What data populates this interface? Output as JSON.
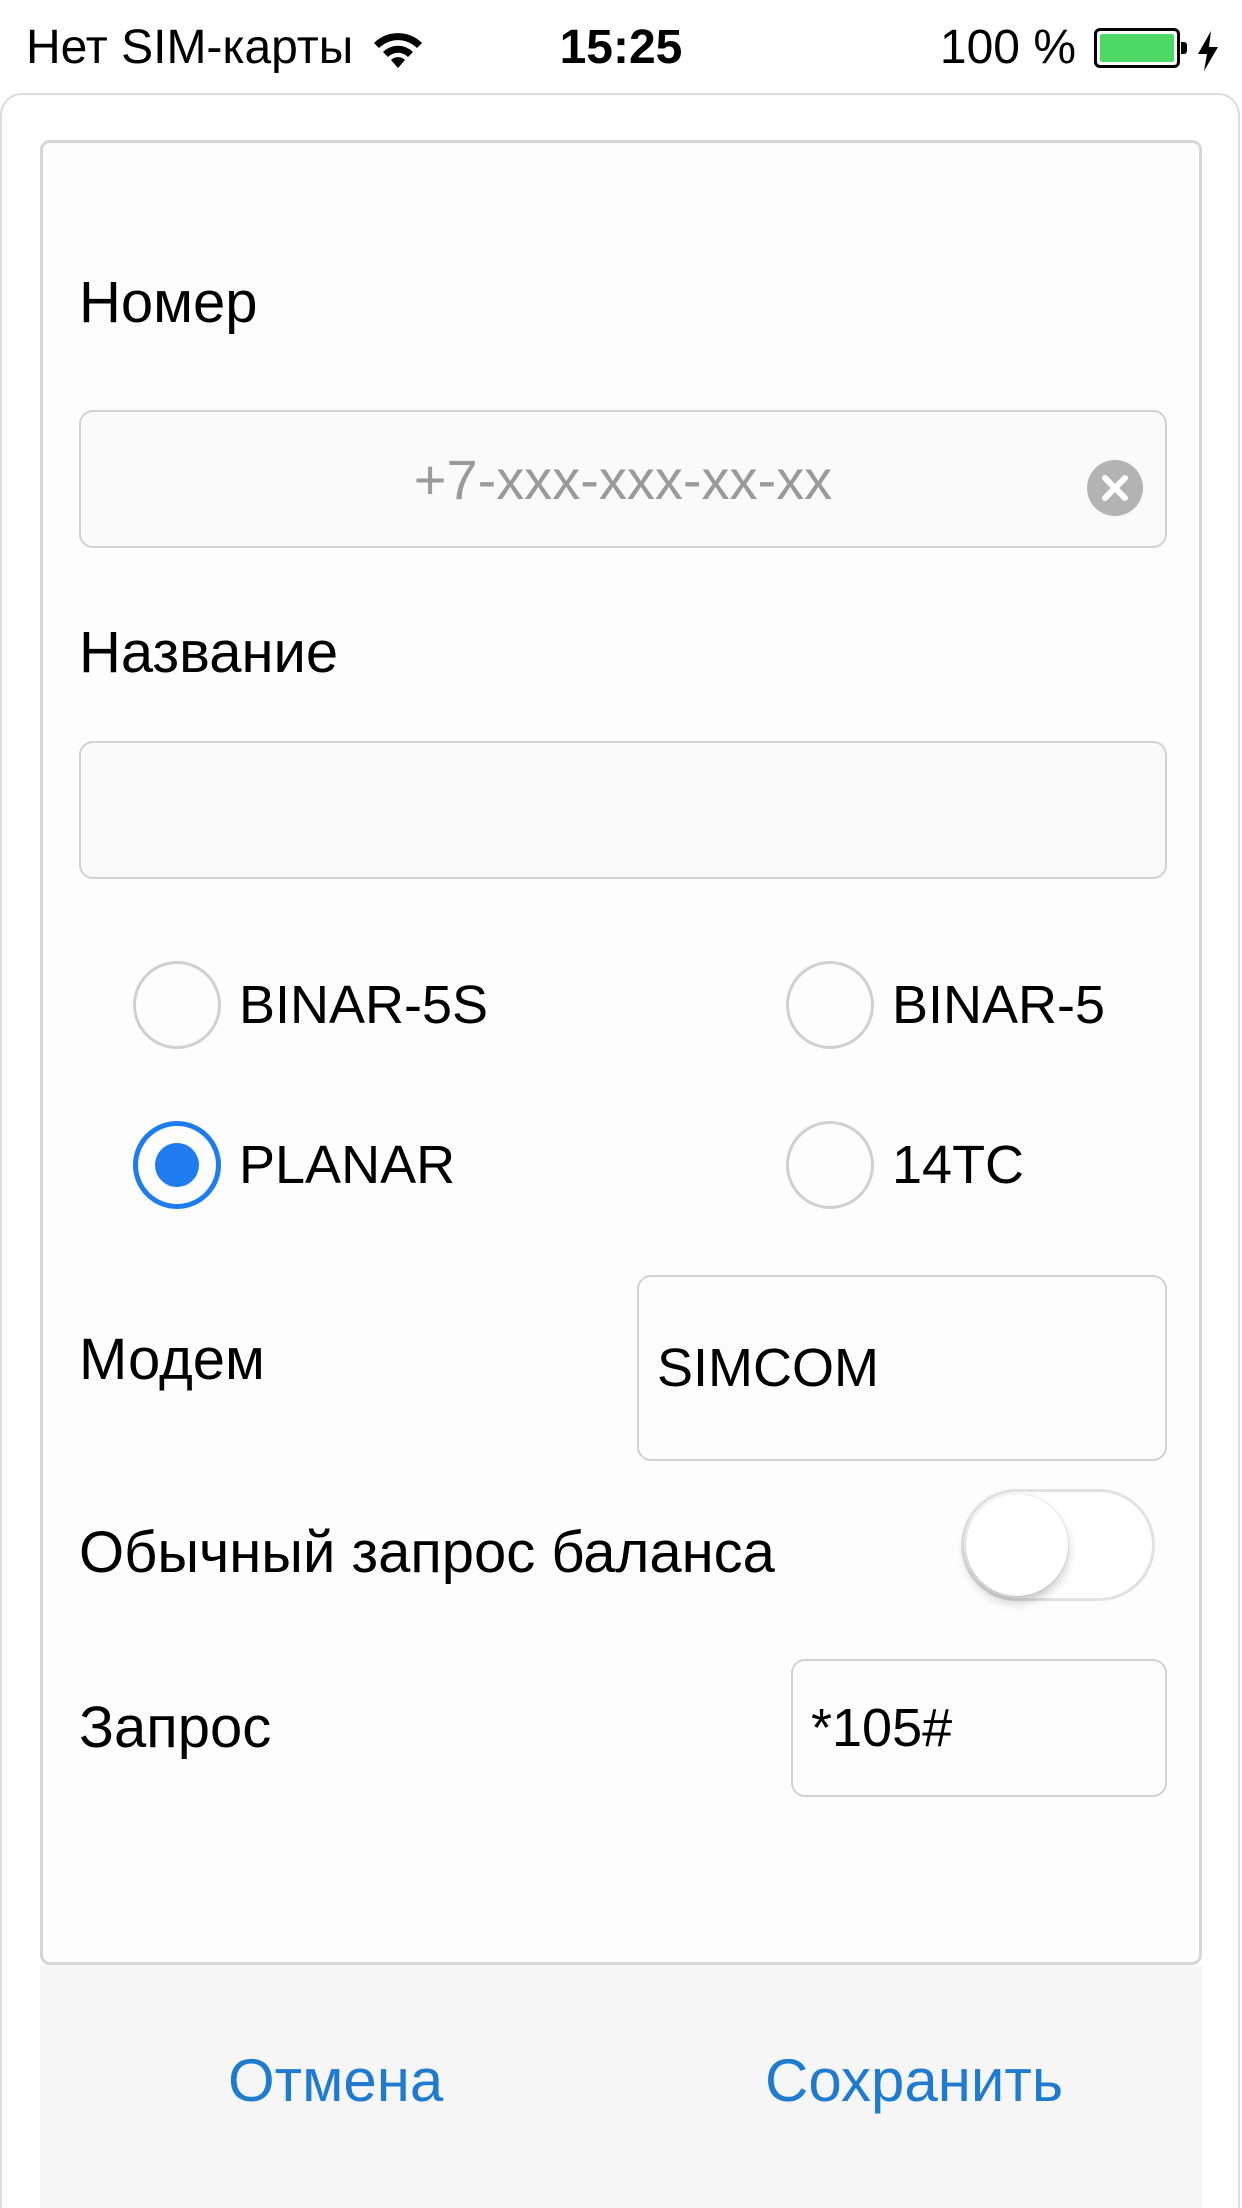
{
  "status_bar": {
    "carrier": "Нет SIM-карты",
    "time": "15:25",
    "battery_percent": "100 %",
    "battery_level": 1.0,
    "battery_color": "#4cd964"
  },
  "form": {
    "number_label": "Номер",
    "number_placeholder": "+7-xxx-xxx-xx-xx",
    "number_value": "",
    "name_label": "Название",
    "name_value": "",
    "device_options": [
      {
        "label": "BINAR-5S",
        "selected": false
      },
      {
        "label": "BINAR-5",
        "selected": false
      },
      {
        "label": "PLANAR",
        "selected": true
      },
      {
        "label": "14TC",
        "selected": false
      }
    ],
    "modem_label": "Модем",
    "modem_value": "SIMCOM",
    "balance_toggle_label": "Обычный запрос баланса",
    "balance_toggle_on": false,
    "request_label": "Запрос",
    "request_value": "*105#"
  },
  "footer": {
    "cancel_label": "Отмена",
    "save_label": "Сохранить"
  },
  "colors": {
    "accent": "#1e7bf0",
    "link": "#1e7bd0"
  }
}
